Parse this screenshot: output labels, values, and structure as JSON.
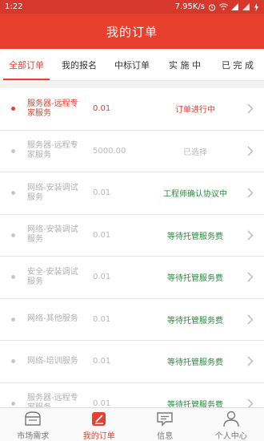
{
  "status_bar": {
    "time": "1:22",
    "speed": "7.95K/s"
  },
  "header": {
    "title": "我的订单"
  },
  "tabs": [
    {
      "label": "全部订单",
      "active": true
    },
    {
      "label": "我的报名",
      "active": false
    },
    {
      "label": "中标订单",
      "active": false
    },
    {
      "label": "实 施 中",
      "active": false
    },
    {
      "label": "已 完 成",
      "active": false
    }
  ],
  "orders": [
    {
      "name": "服务器-远程专家服务",
      "price": "0.01",
      "status": "订单进行中",
      "tone": "red",
      "active": true
    },
    {
      "name": "服务器-远程专家服务",
      "price": "5000.00",
      "status": "已选择",
      "tone": "gray",
      "active": false
    },
    {
      "name": "网络-安装调试服务",
      "price": "0.01",
      "status": "工程师确认协议中",
      "tone": "green",
      "active": false
    },
    {
      "name": "网络-安装调试服务",
      "price": "0.01",
      "status": "等待托管服务费",
      "tone": "green",
      "active": false
    },
    {
      "name": "安全-安装调试服务",
      "price": "0.01",
      "status": "等待托管服务费",
      "tone": "green",
      "active": false
    },
    {
      "name": "网络-其他服务",
      "price": "0.01",
      "status": "等待托管服务费",
      "tone": "green",
      "active": false
    },
    {
      "name": "网络-培训服务",
      "price": "0.01",
      "status": "等待托管服务费",
      "tone": "green",
      "active": false
    },
    {
      "name": "服务器-远程专家服务",
      "price": "0.01",
      "status": "等待托管服务费",
      "tone": "green",
      "active": false
    }
  ],
  "bottom_nav": [
    {
      "label": "市场需求",
      "icon": "market-icon",
      "active": false
    },
    {
      "label": "我的订单",
      "icon": "orders-icon",
      "active": true
    },
    {
      "label": "信息",
      "icon": "message-icon",
      "active": false
    },
    {
      "label": "个人中心",
      "icon": "profile-icon",
      "active": false
    }
  ],
  "colors": {
    "accent": "#e8402f",
    "status_bar": "#d6392b",
    "green": "#2a8a3e"
  }
}
